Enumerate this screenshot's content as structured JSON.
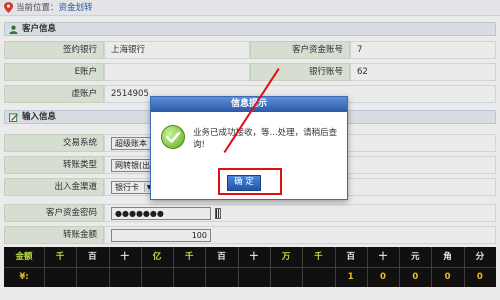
{
  "breadcrumb": {
    "prefix": "当前位置：",
    "link": "资金划转"
  },
  "sections": {
    "customer": "客户信息",
    "input": "输入信息"
  },
  "customer": {
    "bank_label": "签约银行",
    "bank_value": "上海银行",
    "acct_label": "客户资金账号",
    "acct_value": "7",
    "e_label": "E账户",
    "e_value": "",
    "bankno_label": "银行账号",
    "bankno_value": "62",
    "virtual_label": "虚账户",
    "virtual_value": "2514905"
  },
  "input": {
    "trade_label": "交易系统",
    "trade_value": "超级账本",
    "type_label": "转账类型",
    "type_value": "网转银(出)",
    "channel_label": "出入金渠道",
    "channel_value": "银行卡",
    "pwd_label": "客户资金密码",
    "pwd_value": "●●●●●●●",
    "amount_label": "转账金额",
    "amount_value": "100"
  },
  "amount_grid": {
    "header": [
      "金额",
      "千",
      "百",
      "十",
      "亿",
      "千",
      "百",
      "十",
      "万",
      "千",
      "百",
      "十",
      "元",
      "角",
      "分"
    ],
    "values": [
      "¥:",
      "",
      "",
      "",
      "",
      "",
      "",
      "",
      "",
      "",
      "1",
      "0",
      "0",
      "0",
      "0"
    ]
  },
  "modal": {
    "title": "信息提示",
    "message": "业务已成功接收，等...处理，请稍后查询!",
    "ok": "确 定"
  },
  "colors": {
    "accent": "#2a5aa8",
    "highlight": "#e01010",
    "grid_green": "#c9f542",
    "grid_yellow": "#ffd21a"
  },
  "icons": {
    "location": "pin-icon",
    "customer": "person-icon",
    "input": "pencil-icon",
    "success": "check-icon"
  }
}
